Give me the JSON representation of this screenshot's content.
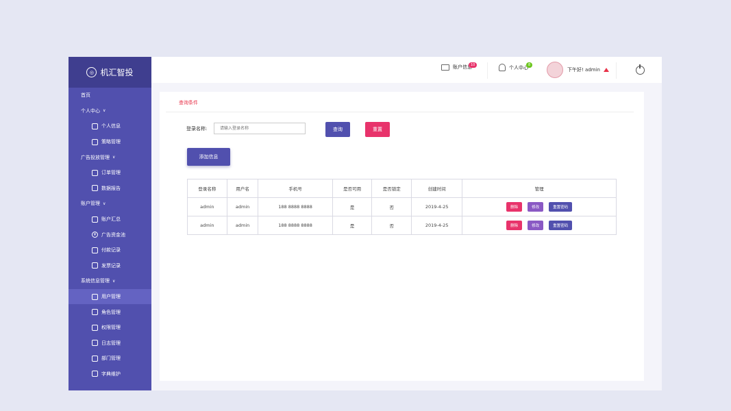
{
  "brand": {
    "name": "机汇智投"
  },
  "sidebar": {
    "items": [
      {
        "label": "首页",
        "level": "top"
      },
      {
        "label": "个人中心",
        "level": "top",
        "expand": true
      },
      {
        "label": "个人信息",
        "level": "sub",
        "icon": "user-icon"
      },
      {
        "label": "策略管理",
        "level": "sub",
        "icon": "strategy-icon"
      },
      {
        "label": "广告投放管理",
        "level": "top",
        "expand": true
      },
      {
        "label": "订单管理",
        "level": "sub",
        "icon": "order-icon"
      },
      {
        "label": "数据报告",
        "level": "sub",
        "icon": "report-icon"
      },
      {
        "label": "账户管理",
        "level": "top",
        "expand": true
      },
      {
        "label": "账户汇总",
        "level": "sub",
        "icon": "account-summary-icon"
      },
      {
        "label": "广告资金池",
        "level": "sub",
        "icon": "yen-icon"
      },
      {
        "label": "付款记录",
        "level": "sub",
        "icon": "payment-icon"
      },
      {
        "label": "发票记录",
        "level": "sub",
        "icon": "invoice-icon"
      },
      {
        "label": "系统信息管理",
        "level": "top",
        "expand": true
      },
      {
        "label": "用户管理",
        "level": "sub",
        "icon": "user-manage-icon",
        "active": true
      },
      {
        "label": "角色管理",
        "level": "sub",
        "icon": "role-icon"
      },
      {
        "label": "权限管理",
        "level": "sub",
        "icon": "permission-icon"
      },
      {
        "label": "日志管理",
        "level": "sub",
        "icon": "log-icon"
      },
      {
        "label": "部门管理",
        "level": "sub",
        "icon": "department-icon"
      },
      {
        "label": "字典维护",
        "level": "sub",
        "icon": "dictionary-icon"
      }
    ]
  },
  "header": {
    "account_info": {
      "label": "账户信息",
      "badge": "10",
      "badge_color": "#e8336b"
    },
    "personal_center": {
      "label": "个人中心",
      "badge": "8",
      "badge_color": "#6cc61e"
    },
    "greeting": "下午好! admin"
  },
  "search": {
    "section_title": "查询条件",
    "label": "登录名称:",
    "placeholder": "请输入登录名称",
    "query_label": "查询",
    "reset_label": "重置",
    "add_label": "添加信息"
  },
  "table": {
    "headers": [
      "登录名称",
      "用户名",
      "手机号",
      "是否可用",
      "是否锁定",
      "创建时间",
      "管理"
    ],
    "rows": [
      [
        "admin",
        "admin",
        "188 8888 8888",
        "是",
        "否",
        "2019-4-25"
      ],
      [
        "admin",
        "admin",
        "188 8888 8888",
        "是",
        "否",
        "2019-4-25"
      ]
    ],
    "actions": {
      "delete": "删除",
      "edit": "修改",
      "reset_pwd": "重置密码"
    }
  },
  "colors": {
    "primary": "#5150ae",
    "danger": "#e8336b",
    "edit": "#8a59c4"
  }
}
